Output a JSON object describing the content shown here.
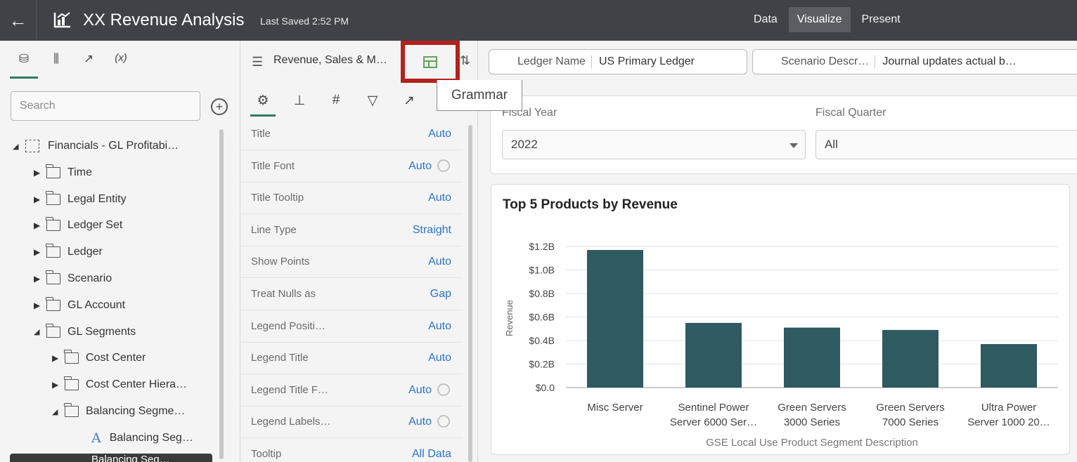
{
  "topbar": {
    "back_icon": "arrow-left-icon",
    "app_icon": "chart-icon",
    "title": "XX Revenue Analysis",
    "saved": "Last Saved 2:52 PM",
    "modes": [
      {
        "label": "Data",
        "active": false
      },
      {
        "label": "Visualize",
        "active": true
      },
      {
        "label": "Present",
        "active": false
      }
    ]
  },
  "left_pane": {
    "tabs": [
      "database-icon",
      "bar-chart-icon",
      "trend-icon",
      "expression-icon"
    ],
    "tab_glyphs": [
      "⛁",
      "⫼",
      "↗",
      "(x)"
    ],
    "search_placeholder": "Search",
    "tree": [
      {
        "label": "Financials - GL Profitabi…",
        "depth": 0,
        "type": "subject",
        "expanded": true
      },
      {
        "label": "Time",
        "depth": 1,
        "type": "folder",
        "expanded": false
      },
      {
        "label": "Legal Entity",
        "depth": 1,
        "type": "folder",
        "expanded": false
      },
      {
        "label": "Ledger Set",
        "depth": 1,
        "type": "folder",
        "expanded": false
      },
      {
        "label": "Ledger",
        "depth": 1,
        "type": "folder",
        "expanded": false
      },
      {
        "label": "Scenario",
        "depth": 1,
        "type": "folder",
        "expanded": false
      },
      {
        "label": "GL Account",
        "depth": 1,
        "type": "folder",
        "expanded": false
      },
      {
        "label": "GL Segments",
        "depth": 1,
        "type": "folder",
        "expanded": true
      },
      {
        "label": "Cost Center",
        "depth": 2,
        "type": "folder",
        "expanded": false
      },
      {
        "label": "Cost Center Hiera…",
        "depth": 2,
        "type": "folder",
        "expanded": false
      },
      {
        "label": "Balancing Segme…",
        "depth": 2,
        "type": "folder",
        "expanded": true
      },
      {
        "label": "Balancing Seg…",
        "depth": 3,
        "type": "attribute"
      }
    ],
    "selected_partial": "Balancing Seg…"
  },
  "properties_pane": {
    "viz_name": "Revenue, Sales & M…",
    "grammar_tooltip": "Grammar",
    "tabs": [
      "gear-icon",
      "axis-icon",
      "hash-icon",
      "filter-icon",
      "analytics-icon"
    ],
    "tab_glyphs": [
      "⚙",
      "⊥",
      "#",
      "▽",
      "↗"
    ],
    "rows": [
      {
        "label": "Title",
        "value": "Auto",
        "reset": false
      },
      {
        "label": "Title Font",
        "value": "Auto",
        "reset": true
      },
      {
        "label": "Title Tooltip",
        "value": "Auto",
        "reset": false
      },
      {
        "label": "Line Type",
        "value": "Straight",
        "reset": false
      },
      {
        "label": "Show Points",
        "value": "Auto",
        "reset": false
      },
      {
        "label": "Treat Nulls as",
        "value": "Gap",
        "reset": false
      },
      {
        "label": "Legend Positi…",
        "value": "Auto",
        "reset": false
      },
      {
        "label": "Legend Title",
        "value": "Auto",
        "reset": false
      },
      {
        "label": "Legend Title F…",
        "value": "Auto",
        "reset": true
      },
      {
        "label": "Legend Labels…",
        "value": "Auto",
        "reset": true
      },
      {
        "label": "Tooltip",
        "value": "All Data",
        "reset": false
      }
    ]
  },
  "canvas": {
    "chips": [
      {
        "key": "Ledger Name",
        "value": "US Primary Ledger"
      },
      {
        "key": "Scenario Descr…",
        "value": "Journal updates actual b…"
      }
    ],
    "filters": [
      {
        "label": "Fiscal Year",
        "value": "2022",
        "dropdown": true
      },
      {
        "label": "Fiscal Quarter",
        "value": "All",
        "dropdown": false
      }
    ]
  },
  "chart_data": {
    "type": "bar",
    "title": "Top 5 Products by Revenue",
    "xlabel": "GSE Local Use Product Segment Description",
    "ylabel": "Revenue",
    "categories": [
      [
        "Misc Server"
      ],
      [
        "Sentinel Power",
        "Server 6000 Ser…"
      ],
      [
        "Green Servers",
        "3000 Series"
      ],
      [
        "Green Servers",
        "7000 Series"
      ],
      [
        "Ultra Power",
        "Server 1000 20…"
      ]
    ],
    "values": [
      1.17,
      0.55,
      0.51,
      0.49,
      0.37
    ],
    "value_unit": "billion USD",
    "ylim": [
      0,
      1.2
    ],
    "yticks": [
      "$0.0",
      "$0.2B",
      "$0.4B",
      "$0.6B",
      "$0.8B",
      "$1.0B",
      "$1.2B"
    ],
    "grid": true,
    "bar_color": "#2f5a60"
  },
  "colors": {
    "topbar_bg": "#3f4347",
    "accent_green": "#2f7a62",
    "link_blue": "#2a74c3",
    "highlight_red": "#b3211d"
  }
}
